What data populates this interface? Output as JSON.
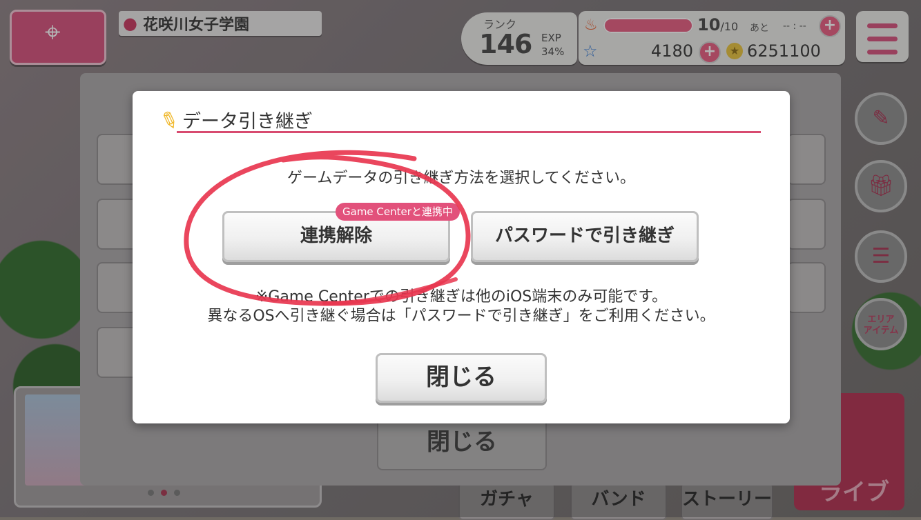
{
  "location": {
    "name": "花咲川女子学園"
  },
  "status": {
    "rank_label": "ランク",
    "rank": "146",
    "exp_label": "EXP",
    "exp_percent": "34%",
    "exp_fraction": 0.34,
    "stamina_value": "10",
    "stamina_max": "/10",
    "stamina_fraction": 1.0,
    "stamina_after_label": "あと",
    "stamina_timer": "-- : --",
    "stars": "4180",
    "coins": "6251100"
  },
  "background_panel": {
    "close_label": "閉じる"
  },
  "bottom_nav": {
    "gacha": "ガチャ",
    "band": "バンド",
    "story": "ストーリー",
    "live": "ライブ"
  },
  "side_buttons": {
    "area_item": "エリア\nアイテム"
  },
  "modal": {
    "title": "データ引き継ぎ",
    "instruction": "ゲームデータの引き継ぎ方法を選択してください。",
    "linked_badge": "Game Centerと連携中",
    "unlink_button": "連携解除",
    "password_button": "パスワードで引き継ぎ",
    "note_line1": "※Game Centerでの引き継ぎは他のiOS端末のみ可能です。",
    "note_line2": "異なるOSへ引き継ぐ場合は「パスワードで引き継ぎ」をご利用ください。",
    "close_button": "閉じる"
  },
  "colors": {
    "accent": "#d84b70",
    "annotation": "#e8364f",
    "badge": "#e2517b"
  },
  "icons": {
    "location": "map-pin-icon",
    "stamina": "flame-icon",
    "star": "star-icon",
    "coin": "coin-icon",
    "menu": "hamburger-menu-icon"
  }
}
